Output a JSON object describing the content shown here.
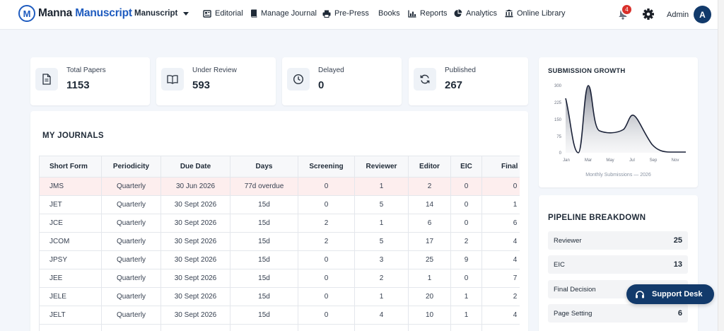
{
  "brand": {
    "name_part1": "Manna",
    "name_part2": "Manuscript",
    "mark": "M"
  },
  "nav": {
    "dropdown_label": "Manuscript",
    "items": [
      {
        "label": "Editorial",
        "icon": "newspaper-icon"
      },
      {
        "label": "Manage Journal",
        "icon": "book-icon"
      },
      {
        "label": "Pre-Press",
        "icon": "printer-icon"
      },
      {
        "label": "Books",
        "icon": ""
      },
      {
        "label": "Reports",
        "icon": "bar-chart-icon"
      },
      {
        "label": "Analytics",
        "icon": "pie-chart-icon"
      },
      {
        "label": "Online Library",
        "icon": "library-icon"
      }
    ],
    "notification_count": "4",
    "user_label": "Admin",
    "avatar_initial": "A"
  },
  "stats": [
    {
      "label": "Total Papers",
      "value": "1153",
      "icon": "document-icon"
    },
    {
      "label": "Under Review",
      "value": "593",
      "icon": "open-book-icon"
    },
    {
      "label": "Delayed",
      "value": "0",
      "icon": "clock-icon"
    },
    {
      "label": "Published",
      "value": "267",
      "icon": "refresh-icon"
    }
  ],
  "journals": {
    "title": "MY JOURNALS",
    "columns": [
      "Short Form",
      "Periodicity",
      "Due Date",
      "Days",
      "Screening",
      "Reviewer",
      "Editor",
      "EIC",
      "Final Ed"
    ],
    "rows": [
      [
        "JMS",
        "Quarterly",
        "30 Jun 2026",
        "77d overdue",
        "0",
        "1",
        "2",
        "0",
        "0"
      ],
      [
        "JET",
        "Quarterly",
        "30 Sept 2026",
        "15d",
        "0",
        "5",
        "14",
        "0",
        "1"
      ],
      [
        "JCE",
        "Quarterly",
        "30 Sept 2026",
        "15d",
        "2",
        "1",
        "6",
        "0",
        "6"
      ],
      [
        "JCOM",
        "Quarterly",
        "30 Sept 2026",
        "15d",
        "2",
        "5",
        "17",
        "2",
        "4"
      ],
      [
        "JPSY",
        "Quarterly",
        "30 Sept 2026",
        "15d",
        "0",
        "3",
        "25",
        "9",
        "4"
      ],
      [
        "JEE",
        "Quarterly",
        "30 Sept 2026",
        "15d",
        "0",
        "2",
        "1",
        "0",
        "7"
      ],
      [
        "JELE",
        "Quarterly",
        "30 Sept 2026",
        "15d",
        "0",
        "1",
        "20",
        "1",
        "2"
      ],
      [
        "JELT",
        "Quarterly",
        "30 Sept 2026",
        "15d",
        "0",
        "4",
        "10",
        "1",
        "4"
      ],
      [
        "",
        "",
        "",
        "",
        "",
        "",
        "",
        "",
        ""
      ]
    ]
  },
  "growth": {
    "title": "SUBMISSION GROWTH",
    "caption": "Monthly Submissions — 2026",
    "y_ticks": [
      "300",
      "225",
      "150",
      "75",
      "0"
    ],
    "x_ticks": [
      "Jan",
      "Mar",
      "May",
      "Jul",
      "Sep",
      "Nov"
    ],
    "line_color": "#1b2238"
  },
  "pipeline": {
    "title": "PIPELINE BREAKDOWN",
    "items": [
      {
        "label": "Reviewer",
        "value": "25"
      },
      {
        "label": "EIC",
        "value": "13"
      },
      {
        "label": "Final Decision",
        "value": ""
      },
      {
        "label": "Page Setting",
        "value": "6"
      }
    ]
  },
  "support": {
    "label": "Support Desk"
  },
  "colors": {
    "brand": "#1e5bbf",
    "navy": "#123a6b",
    "badge": "#d9302b",
    "overdue_row": "#fdeeee"
  }
}
